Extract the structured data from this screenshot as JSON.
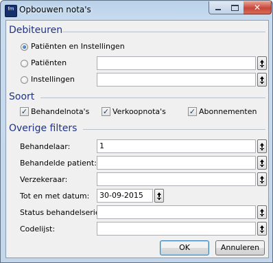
{
  "window": {
    "title": "Opbouwen nota's",
    "app_icon_text": "fm"
  },
  "sections": {
    "debiteuren": "Debiteuren",
    "soort": "Soort",
    "overige": "Overige filters"
  },
  "debiteuren": {
    "options": [
      {
        "label": "Patiënten en Instellingen",
        "selected": true
      },
      {
        "label": "Patiënten",
        "selected": false,
        "value": ""
      },
      {
        "label": "Instellingen",
        "selected": false,
        "value": ""
      }
    ]
  },
  "soort": {
    "checks": [
      {
        "label": "Behandelnota's",
        "checked": true
      },
      {
        "label": "Verkoopnota's",
        "checked": true
      },
      {
        "label": "Abonnementen",
        "checked": true
      }
    ]
  },
  "filters": [
    {
      "label": "Behandelaar:",
      "value": "1"
    },
    {
      "label": "Behandelde patient:",
      "value": ""
    },
    {
      "label": "Verzekeraar:",
      "value": ""
    },
    {
      "label": "Tot en met datum:",
      "value": "30-09-2015"
    },
    {
      "label": "Status behandelserie:",
      "value": ""
    },
    {
      "label": "Codelijst:",
      "value": ""
    }
  ],
  "buttons": {
    "ok": "OK",
    "cancel": "Annuleren"
  },
  "colors": {
    "section_heading": "#1e3287",
    "titlebar": "#b9d1ea",
    "close_button": "#c8453a"
  }
}
